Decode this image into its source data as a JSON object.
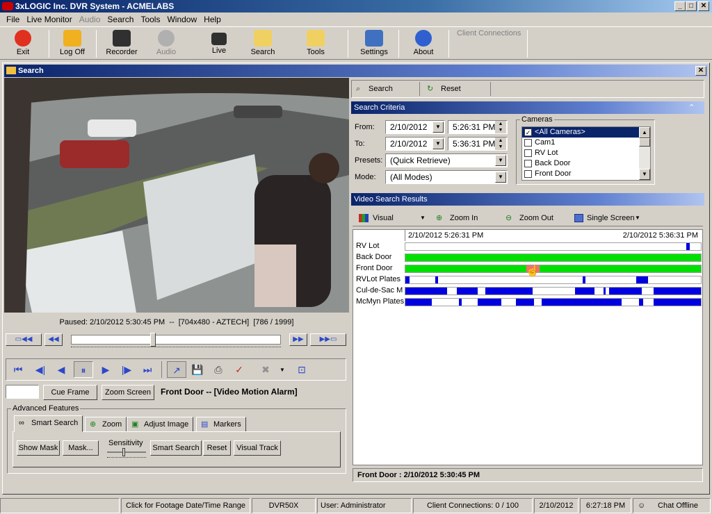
{
  "window": {
    "title": "3xLOGIC Inc. DVR System - ACMELABS",
    "min": "_",
    "max": "□",
    "close": "✕"
  },
  "menu": [
    "File",
    "Live Monitor",
    "Audio",
    "Search",
    "Tools",
    "Window",
    "Help"
  ],
  "toolbar": {
    "exit": "Exit",
    "logoff": "Log Off",
    "recorder": "Recorder",
    "audio": "Audio",
    "live": "Live",
    "search": "Search",
    "tools": "Tools",
    "settings": "Settings",
    "about": "About",
    "client_connections": "Client Connections"
  },
  "search_window": {
    "title": "Search",
    "close": "✕"
  },
  "video": {
    "status": "Paused: 2/10/2012 5:30:45 PM  --  [704x480 - AZTECH]  [786 / 1999]",
    "slider_fraction": 0.39
  },
  "controls": {
    "cue_frame": "Cue Frame",
    "zoom_screen": "Zoom Screen",
    "event_label": "Front Door -- [Video Motion Alarm]",
    "frame_input": ""
  },
  "advanced": {
    "title": "Advanced Features",
    "tabs": [
      "Smart Search",
      "Zoom",
      "Adjust Image",
      "Markers"
    ],
    "show_mask": "Show Mask",
    "mask": "Mask...",
    "sensitivity": "Sensitivity",
    "smart_search": "Smart Search",
    "reset": "Reset",
    "visual_track": "Visual Track"
  },
  "actions": {
    "search": "Search",
    "reset": "Reset"
  },
  "criteria": {
    "title": "Search Criteria",
    "from_label": "From:",
    "to_label": "To:",
    "presets_label": "Presets:",
    "mode_label": "Mode:",
    "from_date": "2/10/2012",
    "from_time": "5:26:31 PM",
    "to_date": "2/10/2012",
    "to_time": "5:36:31 PM",
    "preset": "(Quick Retrieve)",
    "mode": "(All Modes)",
    "cameras_title": "Cameras",
    "cameras": [
      "<All Cameras>",
      "Cam1",
      "RV Lot",
      "Back Door",
      "Front Door"
    ]
  },
  "results": {
    "title": "Video Search Results",
    "visual": "Visual",
    "zoom_in": "Zoom In",
    "zoom_out": "Zoom Out",
    "single_screen": "Single Screen",
    "start": "2/10/2012 5:26:31 PM",
    "end": "2/10/2012 5:36:31 PM",
    "rows": [
      "RV Lot",
      "Back Door",
      "Front Door",
      "RVLot Plates",
      "Cul-de-Sac M",
      "McMyn Plates"
    ],
    "footer": "Front Door : 2/10/2012 5:30:45 PM"
  },
  "statusbar": {
    "hint": "Click for Footage Date/Time Range",
    "server": "DVR50X",
    "user": "User: Administrator",
    "clients": "Client Connections: 0 / 100",
    "date": "2/10/2012",
    "time": "6:27:18 PM",
    "chat": "Chat Offline"
  },
  "colors": {
    "motion": "#00e000",
    "event": "#0000e0",
    "selection": "#f07070"
  }
}
